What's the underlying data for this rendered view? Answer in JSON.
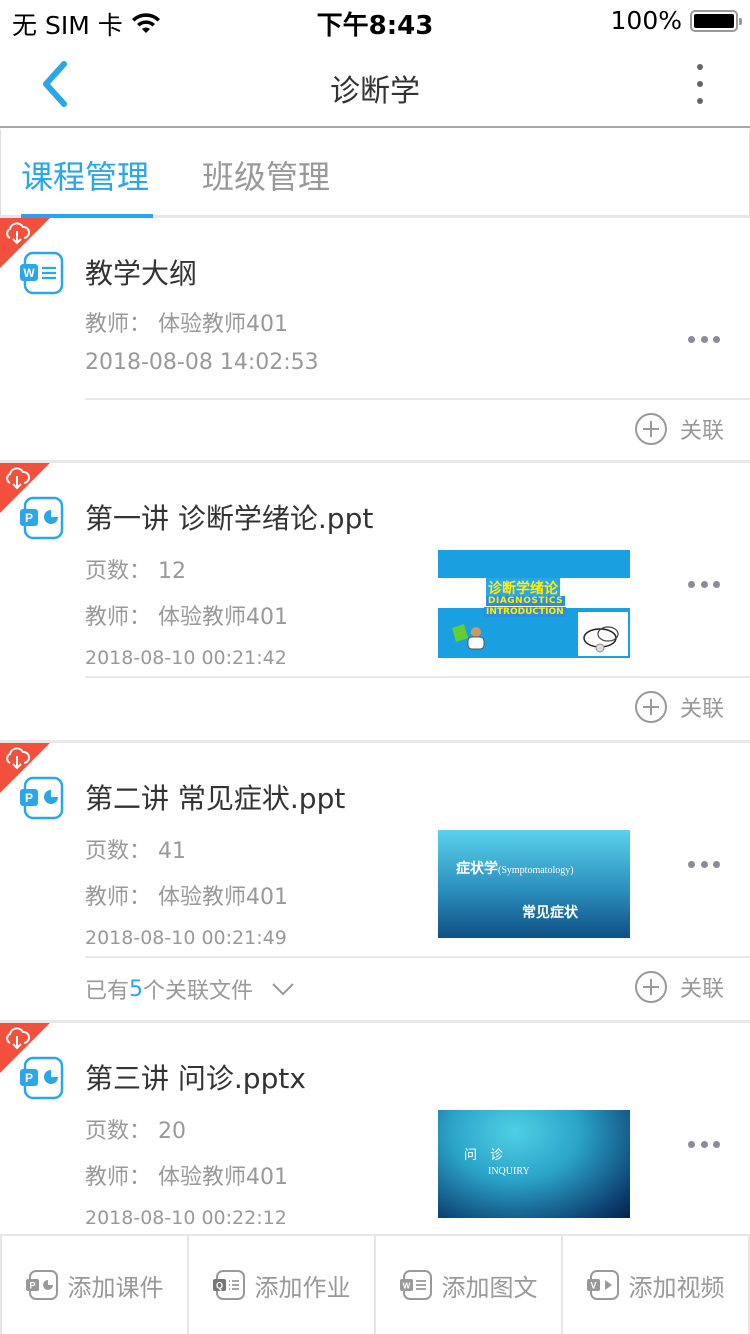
{
  "status_bar": {
    "carrier": "无 SIM 卡",
    "time": "下午8:43",
    "battery": "100%",
    "battery_level": 1.0
  },
  "nav": {
    "title": "诊断学",
    "back_icon": "chevron-left-icon",
    "more_icon": "vertical-ellipsis-icon"
  },
  "tabs": [
    {
      "label": "课程管理",
      "active": true
    },
    {
      "label": "班级管理",
      "active": false
    }
  ],
  "colors": {
    "accent": "#2aa6ea",
    "corner_badge": "#f2503d",
    "muted_text": "#999999"
  },
  "items": [
    {
      "type": "word",
      "title": "教学大纲",
      "teacher": "教师：  体验教师401",
      "datetime": "2018-08-08 14:02:53",
      "link_label": "关联"
    },
    {
      "type": "ppt",
      "title": "第一讲 诊断学绪论.ppt",
      "pages": "页数：  12",
      "teacher": "教师：  体验教师401",
      "datetime": "2018-08-10 00:21:42",
      "thumb": {
        "title_cn": "诊断学绪论",
        "line1": "DIAGNOSTICS",
        "line2": "INTRODUCTION"
      },
      "link_label": "关联"
    },
    {
      "type": "ppt",
      "title": "第二讲 常见症状.ppt",
      "pages": "页数：  41",
      "teacher": "教师：  体验教师401",
      "datetime": "2018-08-10 00:21:49",
      "thumb": {
        "line1": "症状学",
        "line1_en": "(Symptomatology)",
        "line2": "常见症状"
      },
      "related_prefix": "已有",
      "related_count": "5",
      "related_suffix": "个关联文件",
      "link_label": "关联"
    },
    {
      "type": "ppt",
      "title": "第三讲 问诊.pptx",
      "pages": "页数：  20",
      "teacher": "教师：  体验教师401",
      "datetime": "2018-08-10 00:22:12",
      "thumb": {
        "line1": "问　诊",
        "line2": "INQUIRY"
      }
    }
  ],
  "bottom_bar": [
    {
      "label": "添加课件",
      "icon": "ppt-icon"
    },
    {
      "label": "添加作业",
      "icon": "quiz-icon"
    },
    {
      "label": "添加图文",
      "icon": "word-icon"
    },
    {
      "label": "添加视频",
      "icon": "video-icon"
    }
  ]
}
